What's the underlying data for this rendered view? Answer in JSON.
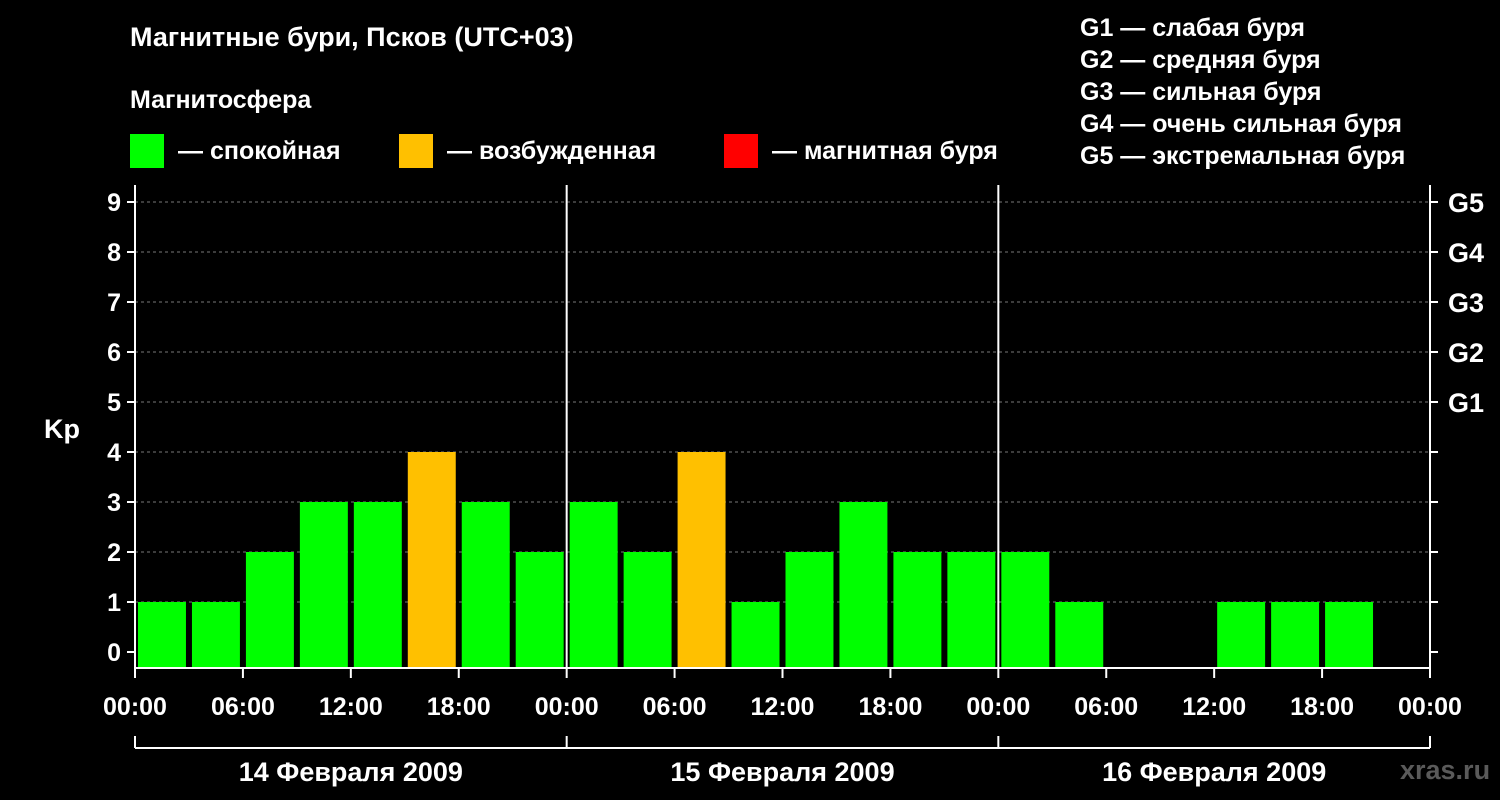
{
  "title": "Магнитные бури, Псков (UTC+03)",
  "subtitle": "Магнитосфера",
  "legend": [
    {
      "label": "— спокойная",
      "color": "#00ff00"
    },
    {
      "label": "— возбужденная",
      "color": "#ffc000"
    },
    {
      "label": "— магнитная буря",
      "color": "#ff0000"
    }
  ],
  "storm_legend": [
    "G1 — слабая буря",
    "G2 — средняя буря",
    "G3 — сильная буря",
    "G4 — очень сильная буря",
    "G5 — экстремальная буря"
  ],
  "watermark": "xras.ru",
  "chart_data": {
    "type": "bar",
    "ylabel": "Kp",
    "ylim": [
      0,
      9
    ],
    "yticks": [
      "0",
      "1",
      "2",
      "3",
      "4",
      "5",
      "6",
      "7",
      "8",
      "9"
    ],
    "right_ticks": [
      {
        "kp": 5,
        "label": "G1"
      },
      {
        "kp": 6,
        "label": "G2"
      },
      {
        "kp": 7,
        "label": "G3"
      },
      {
        "kp": 8,
        "label": "G4"
      },
      {
        "kp": 9,
        "label": "G5"
      }
    ],
    "xticks": [
      "00:00",
      "06:00",
      "12:00",
      "18:00",
      "00:00",
      "06:00",
      "12:00",
      "18:00",
      "00:00",
      "06:00",
      "12:00",
      "18:00",
      "00:00"
    ],
    "days": [
      "14 Февраля 2009",
      "15 Февраля 2009",
      "16 Февраля 2009"
    ],
    "interval_hours": 3,
    "values": [
      1,
      1,
      2,
      3,
      3,
      4,
      3,
      2,
      3,
      2,
      4,
      1,
      2,
      3,
      2,
      2,
      2,
      1,
      null,
      null,
      1,
      1,
      1,
      null
    ],
    "colors": {
      "quiet": "#00ff00",
      "active": "#ffc000",
      "storm": "#ff0000"
    },
    "grid": true
  }
}
